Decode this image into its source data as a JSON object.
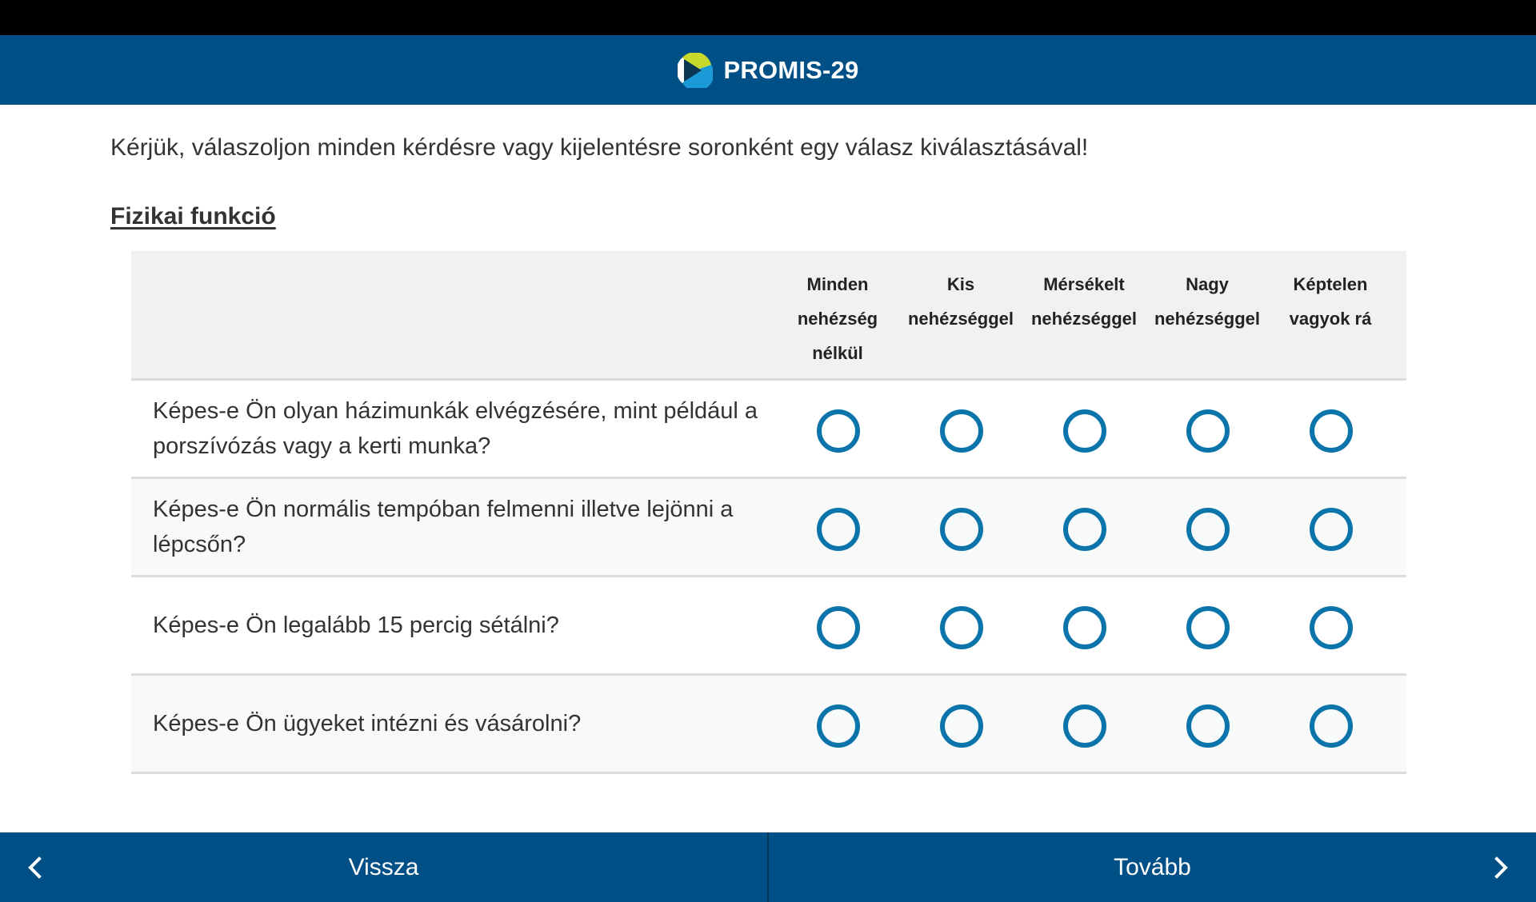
{
  "header": {
    "title": "PROMIS-29",
    "logo_icon": "promis-logo-icon",
    "background_color": "#005087"
  },
  "instruction": "Kérjük, válaszoljon minden kérdésre vagy kijelentésre soronként egy válasz kiválasztásával!",
  "section": {
    "title": "Fizikai funkció"
  },
  "table": {
    "columns": [
      {
        "label": "Minden nehézség nélkül"
      },
      {
        "label": "Kis nehézséggel"
      },
      {
        "label": "Mérsékelt nehézséggel"
      },
      {
        "label": "Nagy nehézséggel"
      },
      {
        "label": "Képtelen vagyok rá"
      }
    ],
    "rows": [
      {
        "question": "Képes-e Ön olyan házimunkák elvégzésére, mint például a porszívózás vagy a kerti munka?"
      },
      {
        "question": "Képes-e Ön normális tempóban felmenni illetve lejönni a lépcsőn?"
      },
      {
        "question": "Képes-e Ön legalább 15 percig sétálni?"
      },
      {
        "question": "Képes-e Ön ügyeket intézni és vásárolni?"
      }
    ],
    "radio_color": "#0a74ab"
  },
  "footer": {
    "back_label": "Vissza",
    "next_label": "Tovább",
    "back_icon": "chevron-left-icon",
    "next_icon": "chevron-right-icon"
  }
}
